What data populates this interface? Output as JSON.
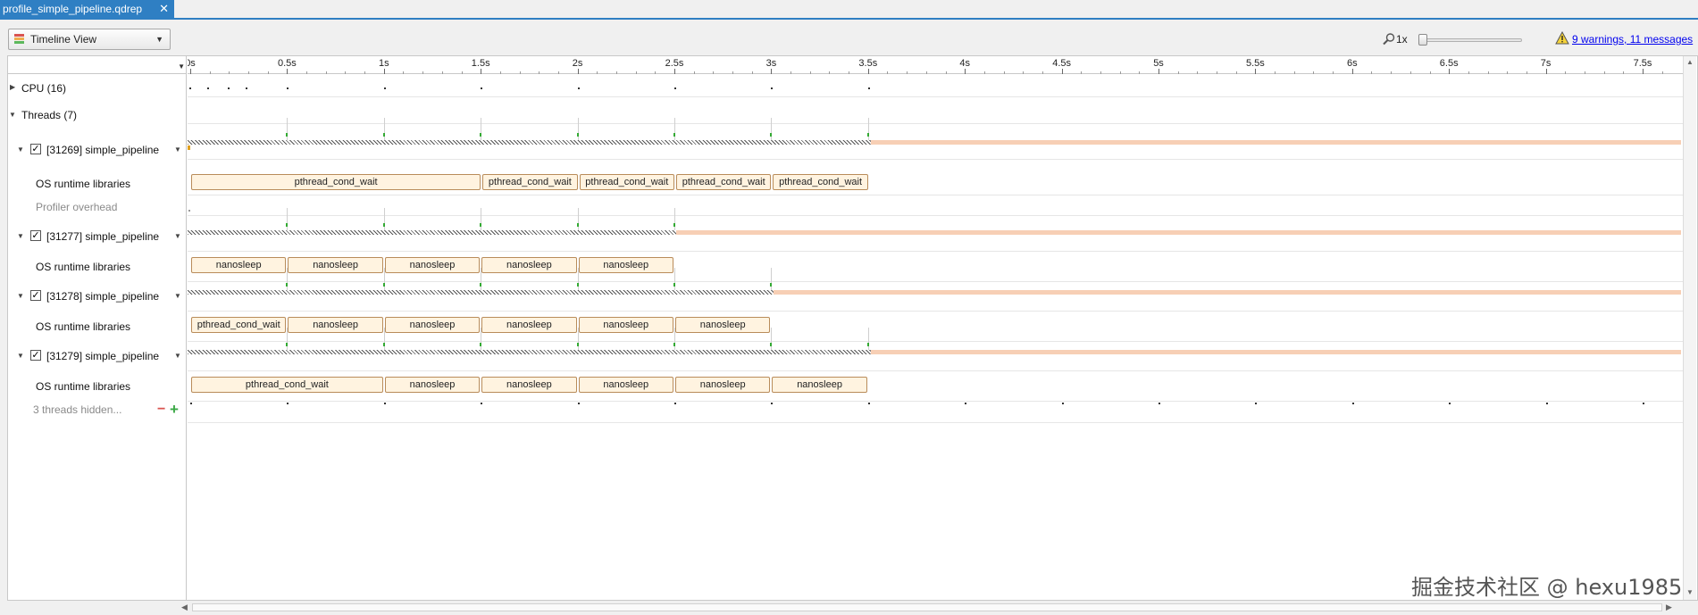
{
  "tab": {
    "title": "profile_simple_pipeline.qdrep",
    "close": "✕"
  },
  "toolbar": {
    "view": "Timeline View",
    "zoom_level": "1x",
    "warnings_link": "9 warnings, 11 messages"
  },
  "ruler": {
    "labels": [
      "0s",
      "0.5s",
      "1s",
      "1.5s",
      "2s",
      "2.5s",
      "3s",
      "3.5s",
      "4s",
      "4.5s",
      "5s",
      "5.5s",
      "6s",
      "6.5s",
      "7s",
      "7.5s"
    ]
  },
  "tree": {
    "cpu": "CPU (16)",
    "threads": "Threads (7)",
    "thread_items": [
      {
        "label": "[31269] simple_pipeline"
      },
      {
        "label": "[31277] simple_pipeline"
      },
      {
        "label": "[31278] simple_pipeline"
      },
      {
        "label": "[31279] simple_pipeline"
      }
    ],
    "os_runtime": "OS runtime libraries",
    "profiler_overhead": "Profiler overhead",
    "hidden": "3 threads hidden...",
    "checkmark": "✓"
  },
  "rows": {
    "t1": [
      "pthread_cond_wait",
      "pthread_cond_wait",
      "pthread_cond_wait",
      "pthread_cond_wait",
      "pthread_cond_wait"
    ],
    "t2": [
      "nanosleep",
      "nanosleep",
      "nanosleep",
      "nanosleep",
      "nanosleep"
    ],
    "t3": [
      "pthread_cond_wait",
      "nanosleep",
      "nanosleep",
      "nanosleep",
      "nanosleep",
      "nanosleep"
    ],
    "t4": [
      "pthread_cond_wait",
      "nanosleep",
      "nanosleep",
      "nanosleep",
      "nanosleep",
      "nanosleep"
    ]
  },
  "colors": {
    "accent": "#2f7fc3",
    "utilization": "#f7cfb5",
    "api_fill": "#fff3e0",
    "api_border": "#b98c5a"
  },
  "watermark": "掘金技术社区 @ hexu1985"
}
